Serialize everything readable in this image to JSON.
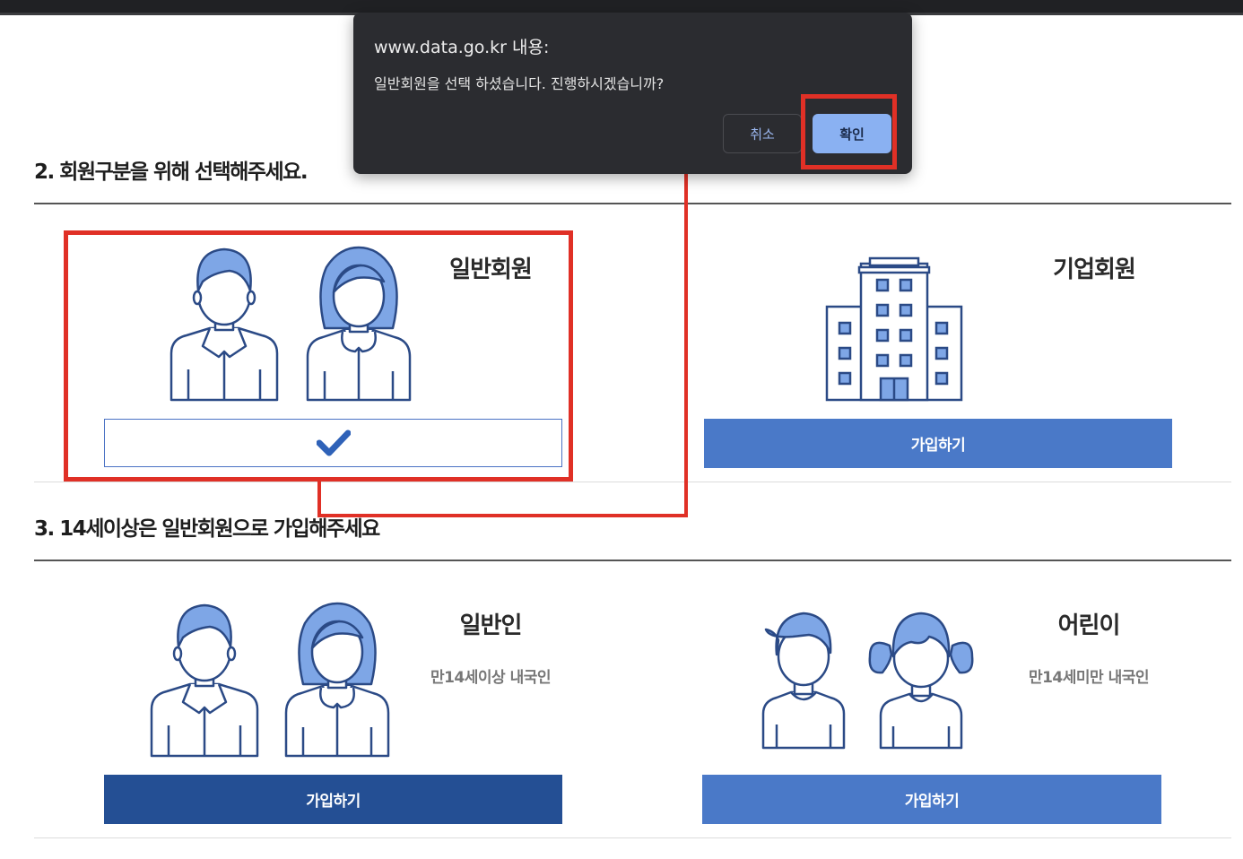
{
  "dialog": {
    "title": "www.data.go.kr 내용:",
    "message": "일반회원을 선택 하셨습니다. 진행하시겠습니까?",
    "cancel_label": "취소",
    "ok_label": "확인"
  },
  "section2": {
    "title": "2. 회원구분을 위해 선택해주세요.",
    "general_member": {
      "title": "일반회원",
      "selected": true
    },
    "corporate_member": {
      "title": "기업회원",
      "button_label": "가입하기"
    }
  },
  "section3": {
    "title": "3. 14세이상은 일반회원으로 가입해주세요",
    "adult": {
      "title": "일반인",
      "subtitle": "만14세이상 내국인",
      "button_label": "가입하기"
    },
    "child": {
      "title": "어린이",
      "subtitle": "만14세미만 내국인",
      "button_label": "가입하기"
    }
  },
  "colors": {
    "accent_light": "#4a79c8",
    "accent_dark": "#244f94",
    "annotation": "#e03026",
    "icon_fill": "#7ea6e6",
    "icon_stroke": "#2b4a86"
  }
}
